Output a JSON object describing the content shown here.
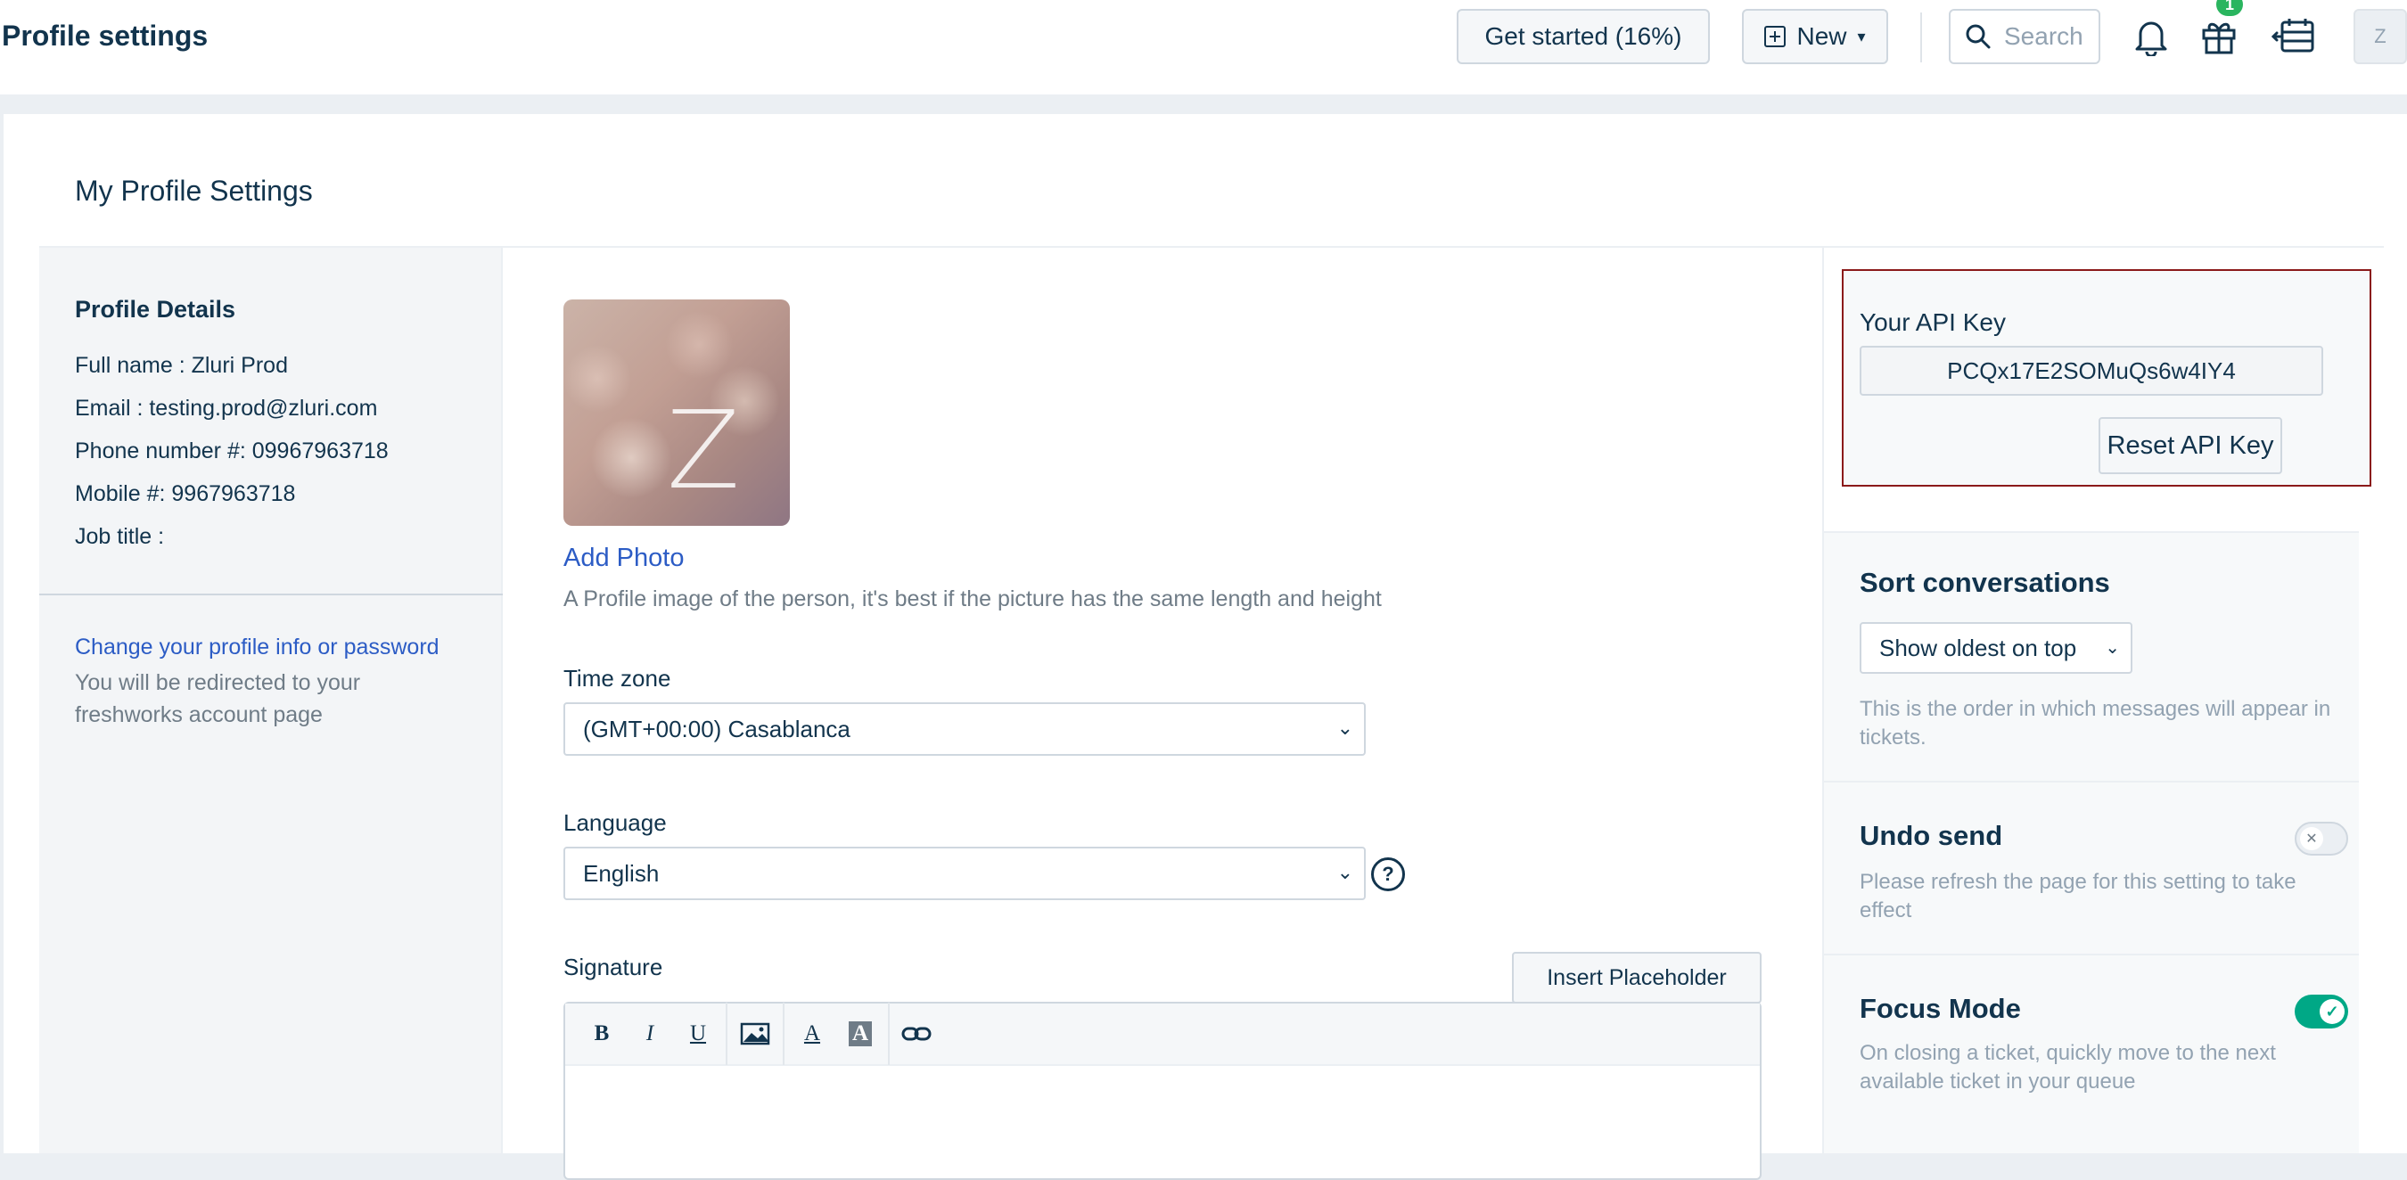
{
  "header": {
    "title": "Profile settings",
    "get_started_label": "Get started (16%)",
    "new_label": "New",
    "search_placeholder": "Search",
    "gift_badge": "1",
    "avatar_letter": "Z"
  },
  "page": {
    "section_title": "My Profile Settings"
  },
  "profile_details": {
    "heading": "Profile Details",
    "rows": [
      {
        "label": "Full name : ",
        "value": "Zluri Prod"
      },
      {
        "label": "Email : ",
        "value": "testing.prod@zluri.com"
      },
      {
        "label": "Phone number #: ",
        "value": "09967963718"
      },
      {
        "label": "Mobile #: ",
        "value": "9967963718"
      },
      {
        "label": "Job title : ",
        "value": ""
      }
    ],
    "change_link": "Change your profile info or password",
    "redirect_note": "You will be redirected to your freshworks account page"
  },
  "photo": {
    "letter": "Z",
    "add_label": "Add Photo",
    "hint": "A Profile image of the person, it's best if the picture has the same length and height"
  },
  "timezone": {
    "label": "Time zone",
    "value": "(GMT+00:00) Casablanca"
  },
  "language": {
    "label": "Language",
    "value": "English",
    "help": "?"
  },
  "signature": {
    "label": "Signature",
    "insert_placeholder": "Insert Placeholder",
    "toolbar": {
      "bold": "B",
      "italic": "I",
      "underline": "U",
      "font_color": "A",
      "bg_color": "A"
    }
  },
  "api": {
    "title": "Your API Key",
    "key": "PCQx17E2SOMuQs6w4IY4",
    "reset_label": "Reset API Key",
    "border_color": "#8b1a1a"
  },
  "sort": {
    "heading": "Sort conversations",
    "value": "Show oldest on top",
    "note": "This is the order in which messages will appear in tickets."
  },
  "undo": {
    "heading": "Undo send",
    "note": "Please refresh the page for this setting to take effect",
    "enabled": false
  },
  "focus": {
    "heading": "Focus Mode",
    "note": "On closing a ticket, quickly move to the next available ticket in your queue",
    "enabled": true,
    "toggle_color": "#00a886"
  }
}
